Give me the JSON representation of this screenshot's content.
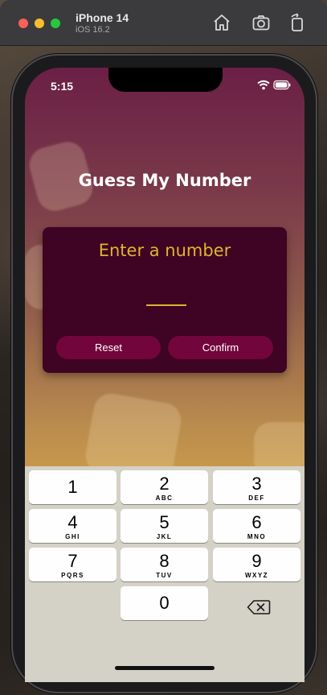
{
  "simulator": {
    "device_name": "iPhone 14",
    "os_version": "iOS 16.2"
  },
  "status_bar": {
    "time": "5:15"
  },
  "app": {
    "title": "Guess My Number",
    "card": {
      "prompt": "Enter a number",
      "input_value": "",
      "reset_label": "Reset",
      "confirm_label": "Confirm"
    },
    "colors": {
      "card_bg": "#3f0323",
      "accent": "#ddb52f",
      "button_bg": "#72063c"
    }
  },
  "keyboard": {
    "keys": [
      {
        "num": "1",
        "letters": ""
      },
      {
        "num": "2",
        "letters": "ABC"
      },
      {
        "num": "3",
        "letters": "DEF"
      },
      {
        "num": "4",
        "letters": "GHI"
      },
      {
        "num": "5",
        "letters": "JKL"
      },
      {
        "num": "6",
        "letters": "MNO"
      },
      {
        "num": "7",
        "letters": "PQRS"
      },
      {
        "num": "8",
        "letters": "TUV"
      },
      {
        "num": "9",
        "letters": "WXYZ"
      },
      {
        "num": "0",
        "letters": ""
      }
    ],
    "backspace_icon": "delete-backward-icon"
  }
}
